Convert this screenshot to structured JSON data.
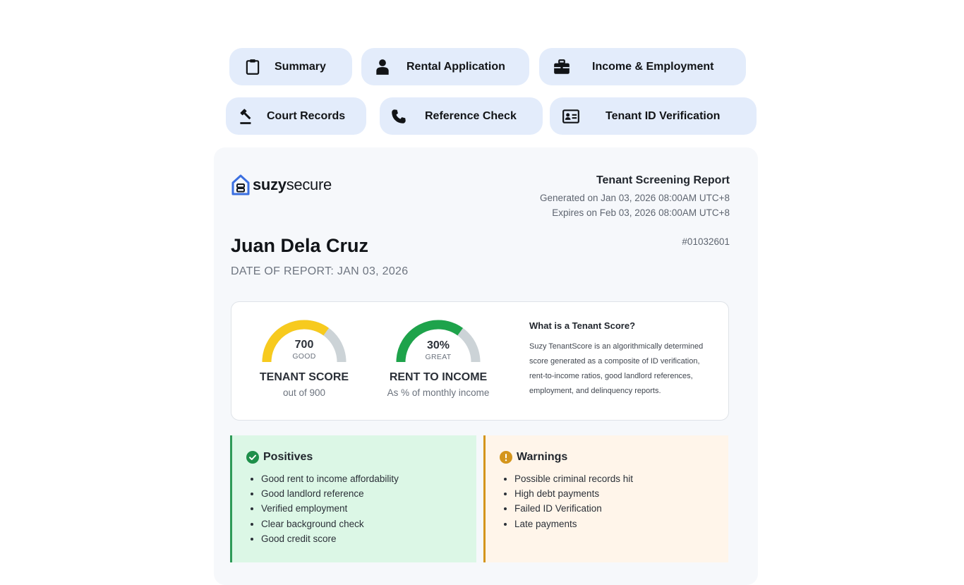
{
  "tabs": [
    {
      "label": "Summary",
      "icon": "clipboard-icon"
    },
    {
      "label": "Rental Application",
      "icon": "person-icon"
    },
    {
      "label": "Income & Employment",
      "icon": "briefcase-icon"
    },
    {
      "label": "Court Records",
      "icon": "gavel-icon"
    },
    {
      "label": "Reference Check",
      "icon": "phone-icon"
    },
    {
      "label": "Tenant ID Verification",
      "icon": "id-card-icon"
    }
  ],
  "brand": {
    "name_bold": "suzy",
    "name_regular": "secure",
    "icon": "house-logo-icon",
    "color": "#3b6fe0"
  },
  "report": {
    "title": "Tenant Screening Report",
    "generated": "Generated on Jan 03, 2026 08:00AM UTC+8",
    "expires": "Expires on Feb 03, 2026 08:00AM UTC+8",
    "id": "#01032601",
    "tenant_name": "Juan Dela Cruz",
    "date_of_report": "DATE OF REPORT: JAN 03, 2026"
  },
  "scores": {
    "tenant": {
      "value": "700",
      "rating": "GOOD",
      "title": "TENANT SCORE",
      "subtitle": "out of 900",
      "fraction": 0.7,
      "color": "#f7ca1e"
    },
    "rent": {
      "value": "30%",
      "rating": "GREAT",
      "title": "RENT TO INCOME",
      "subtitle": "As % of monthly income",
      "fraction": 0.7,
      "color": "#1ea34b"
    },
    "track_color": "#ccd3d7"
  },
  "info": {
    "title": "What is a Tenant Score?",
    "body": "Suzy TenantScore is an algorithmically determined score generated as a composite of ID verification, rent-to-income ratios, good landlord references, employment, and delinquency reports."
  },
  "positives": {
    "title": "Positives",
    "icon": "check-circle-icon",
    "items": [
      "Good rent to income affordability",
      "Good landlord reference",
      "Verified employment",
      "Clear background check",
      "Good credit score"
    ]
  },
  "warnings": {
    "title": "Warnings",
    "icon": "exclamation-circle-icon",
    "items": [
      "Possible criminal records hit",
      "High debt payments",
      "Failed ID Verification",
      "Late payments"
    ]
  }
}
